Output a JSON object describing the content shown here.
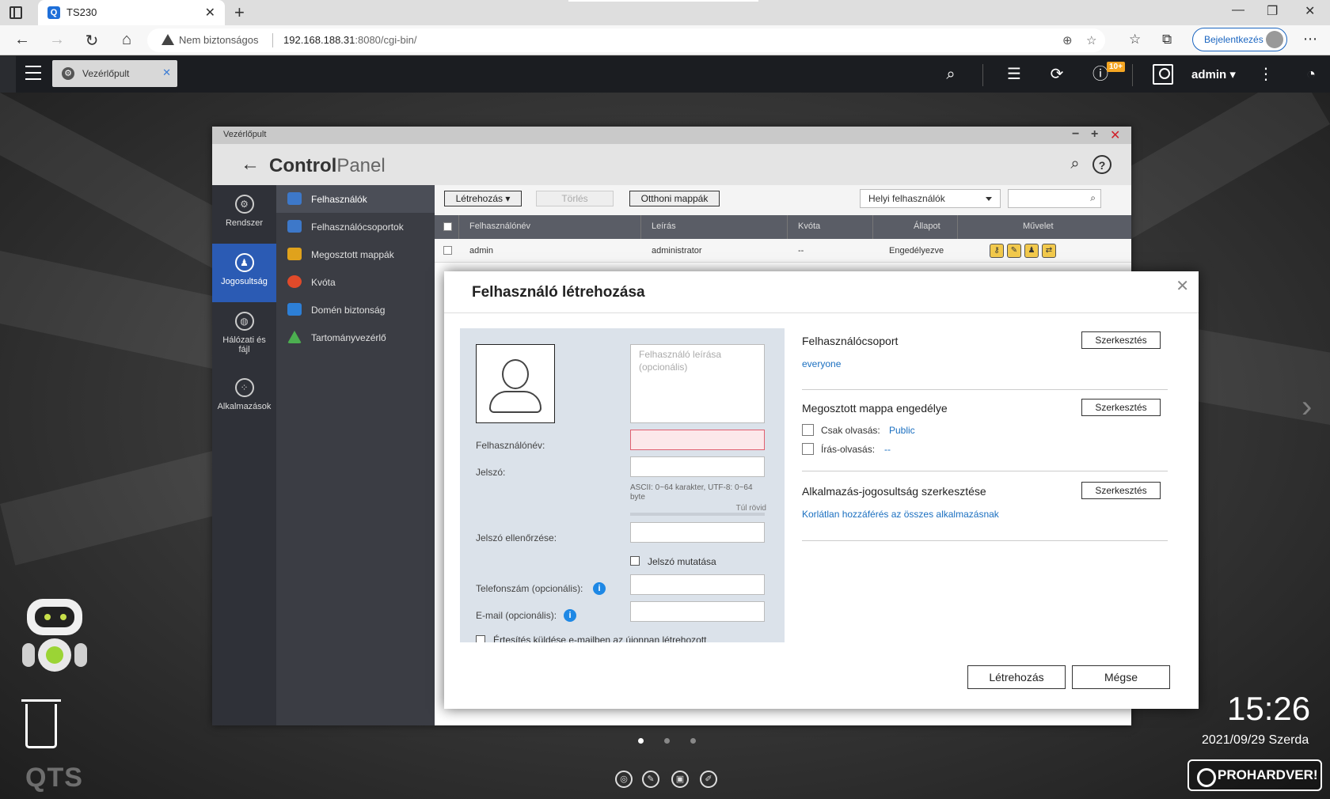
{
  "browser": {
    "tab_title": "TS230",
    "tab_favicon": "Q",
    "security_label": "Nem biztonságos",
    "url_host": "192.168.188.31",
    "url_rest": ":8080/cgi-bin/",
    "signin_label": "Bejelentkezés"
  },
  "qts_bar": {
    "app_tab_label": "Vezérlőpult",
    "notification_badge": "10+",
    "username": "admin ▾"
  },
  "control_panel": {
    "window_title": "Vezérlőpult",
    "title_bold": "Control",
    "title_light": "Panel",
    "nav1": [
      {
        "label": "Rendszer",
        "icon": "gear-icon"
      },
      {
        "label": "Jogosultság",
        "icon": "user-icon",
        "active": true
      },
      {
        "label": "Hálózati és fájl",
        "icon": "globe-icon"
      },
      {
        "label": "Alkalmazások",
        "icon": "apps-icon"
      }
    ],
    "nav2": [
      {
        "label": "Felhasználók",
        "color": "#3d78c9",
        "active": true
      },
      {
        "label": "Felhasználócsoportok",
        "color": "#3d78c9"
      },
      {
        "label": "Megosztott mappák",
        "color": "#e0a21c"
      },
      {
        "label": "Kvóta",
        "color": "#e04a2a"
      },
      {
        "label": "Domén biztonság",
        "color": "#2d7fd6"
      },
      {
        "label": "Tartományvezérlő",
        "color": "#4caf50"
      }
    ],
    "toolbar": {
      "create_label": "Létrehozás ▾",
      "delete_label": "Törlés",
      "home_folders_label": "Otthoni mappák",
      "user_scope": "Helyi felhasználók"
    },
    "table": {
      "headers": [
        "Felhasználónév",
        "Leírás",
        "Kvóta",
        "Állapot",
        "Művelet"
      ],
      "rows": [
        {
          "username": "admin",
          "description": "administrator",
          "quota": "--",
          "status": "Engedélyezve"
        }
      ]
    }
  },
  "modal": {
    "title": "Felhasználó létrehozása",
    "description_placeholder": "Felhasználó leírása (opcionális)",
    "username_label": "Felhasználónév:",
    "password_label": "Jelszó:",
    "password_hint": "ASCII: 0~64 karakter, UTF-8: 0~64 byte",
    "password_strength": "Túl rövid",
    "confirm_label": "Jelszó ellenőrzése:",
    "show_password_label": "Jelszó mutatása",
    "phone_label": "Telefonszám (opcionális):",
    "email_label": "E-mail (opcionális):",
    "notify_label": "Értesítés küldése e-mailben az újonnan létrehozott",
    "group_section": {
      "title": "Felhasználócsoport",
      "edit_label": "Szerkesztés",
      "value": "everyone"
    },
    "share_section": {
      "title": "Megosztott mappa engedélye",
      "edit_label": "Szerkesztés",
      "read_only_label": "Csak olvasás:",
      "read_only_value": "Public",
      "read_write_label": "Írás-olvasás:",
      "read_write_value": "--"
    },
    "app_section": {
      "title": "Alkalmazás-jogosultság szerkesztése",
      "edit_label": "Szerkesztés",
      "value": "Korlátlan hozzáférés az összes alkalmazásnak"
    },
    "create_button": "Létrehozás",
    "cancel_button": "Mégse"
  },
  "desktop": {
    "time": "15:26",
    "date": "2021/09/29 Szerda",
    "logo": "QTS",
    "watermark": "PROHARDVER!"
  }
}
